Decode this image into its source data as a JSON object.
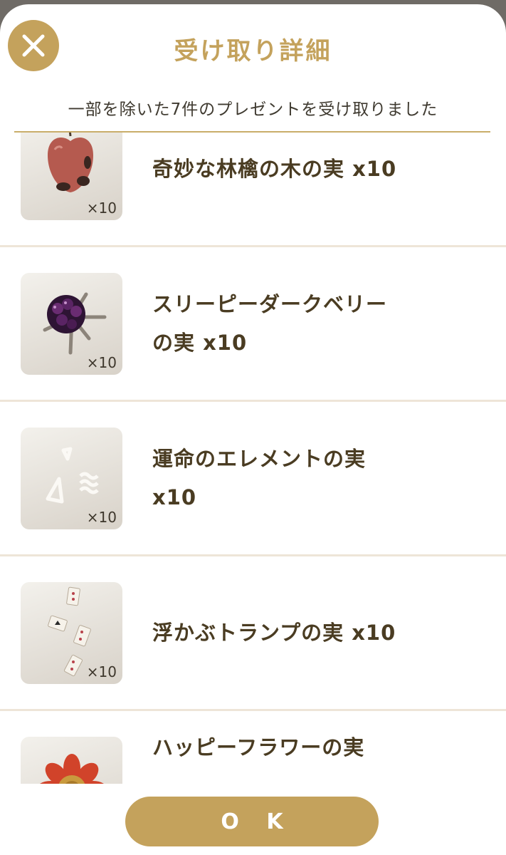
{
  "dialog": {
    "title": "受け取り詳細",
    "subtitle": "一部を除いた7件のプレゼントを受け取りました",
    "close_icon": "close-icon",
    "ok_label": "O K"
  },
  "items": [
    {
      "name": "奇妙な林檎の木の実 x10",
      "qty": "×10",
      "icon": "apple-icon"
    },
    {
      "name": "スリーピーダークベリー\nの実 x10",
      "qty": "×10",
      "icon": "dark-berry-icon"
    },
    {
      "name": "運命のエレメントの実\nx10",
      "qty": "×10",
      "icon": "element-icon"
    },
    {
      "name": "浮かぶトランプの実 x10",
      "qty": "×10",
      "icon": "cards-icon"
    },
    {
      "name": "ハッピーフラワーの実",
      "qty": "",
      "icon": "flower-icon"
    }
  ],
  "colors": {
    "accent": "#c4a25c",
    "text": "#4a3c22",
    "divider": "#eee5d8"
  }
}
